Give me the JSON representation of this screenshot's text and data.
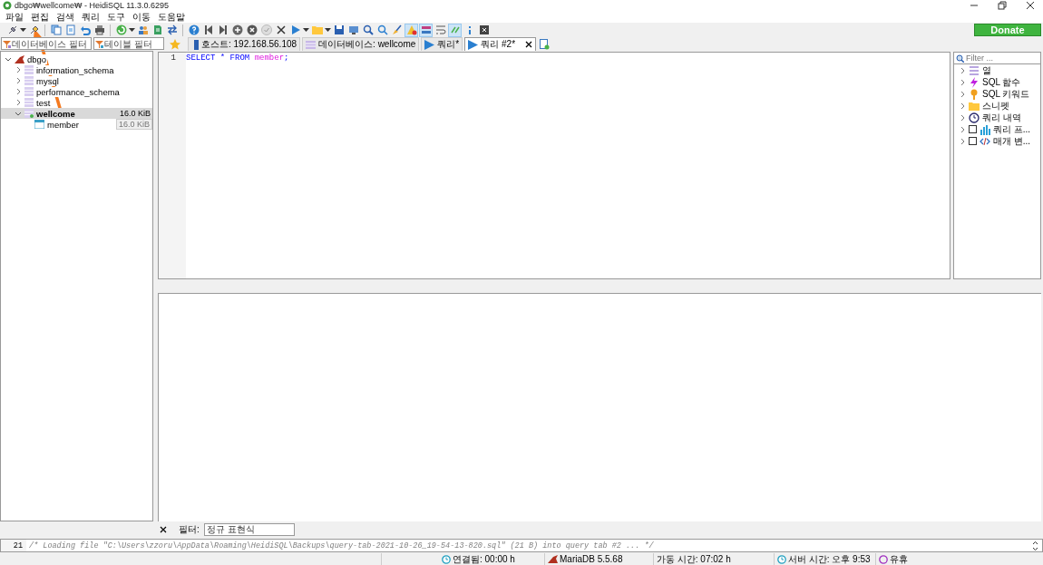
{
  "window": {
    "title": "dbgo₩wellcome₩ - HeidiSQL 11.3.0.6295"
  },
  "menu": [
    "파일",
    "편집",
    "검색",
    "쿼리",
    "도구",
    "이동",
    "도움말"
  ],
  "donate_button": "Donate",
  "filters": [
    {
      "kind": "database",
      "placeholder": "데이터베이스 필터"
    },
    {
      "kind": "table",
      "placeholder": "테이블 필터"
    }
  ],
  "tabs": [
    {
      "kind": "host",
      "label": "호스트: 192.168.56.108",
      "selected": false
    },
    {
      "kind": "database",
      "label": "데이터베이스: wellcome",
      "selected": false
    },
    {
      "kind": "query",
      "label": "쿼리*",
      "selected": false
    },
    {
      "kind": "query",
      "label": "쿼리 #2*",
      "selected": true
    }
  ],
  "tree": [
    {
      "label": "dbgo",
      "kind": "server",
      "expanded": true,
      "selected": false,
      "children": [
        {
          "label": "information_schema",
          "kind": "database",
          "expanded": false,
          "selected": false
        },
        {
          "label": "mysql",
          "kind": "database",
          "expanded": false,
          "selected": false
        },
        {
          "label": "performance_schema",
          "kind": "database",
          "expanded": false,
          "selected": false
        },
        {
          "label": "test",
          "kind": "database",
          "expanded": false,
          "selected": false
        },
        {
          "label": "wellcome",
          "kind": "database",
          "expanded": true,
          "selected": true,
          "size": "16.0 KiB",
          "children": [
            {
              "label": "member",
              "kind": "table",
              "selected": false,
              "size": "16.0 KiB"
            }
          ]
        }
      ]
    }
  ],
  "editor": {
    "lines": [
      {
        "number": "1",
        "tokens": [
          {
            "kind": "keyword",
            "text": "SELECT * FROM "
          },
          {
            "kind": "identifier",
            "text": "member"
          },
          {
            "kind": "keyword",
            "text": ";"
          }
        ]
      }
    ]
  },
  "helper": {
    "placeholder": "Filter ...",
    "items": [
      {
        "kind": "columns",
        "label": "열"
      },
      {
        "kind": "functions",
        "label": "SQL 함수"
      },
      {
        "kind": "keywords",
        "label": "SQL 키워드"
      },
      {
        "kind": "snippets",
        "label": "스니펫"
      },
      {
        "kind": "history",
        "label": "쿼리 내역"
      },
      {
        "kind": "profile",
        "label": "쿼리 프...",
        "checked": false
      },
      {
        "kind": "params",
        "label": "매개 변...",
        "checked": false
      }
    ]
  },
  "result_filter": {
    "label": "필터:",
    "placeholder": "정규 표현식"
  },
  "log": [
    {
      "number": "21",
      "text": "/* Loading file \"C:\\Users\\zzoru\\AppData\\Roaming\\HeidiSQL\\Backups\\query-tab-2021-10-26_19-54-13-820.sql\" (21 B) into query tab #2 ... */"
    }
  ],
  "status_bar": [
    {
      "kind": "blank"
    },
    {
      "kind": "clock",
      "text": "연결됨: 00:00 h"
    },
    {
      "kind": "server",
      "text": "MariaDB 5.5.68"
    },
    {
      "kind": "plain",
      "text": "가동 시간: 07:02 h"
    },
    {
      "kind": "clock",
      "text": "서버 시간: 오후 9:53"
    },
    {
      "kind": "idle",
      "text": "유휴"
    }
  ]
}
